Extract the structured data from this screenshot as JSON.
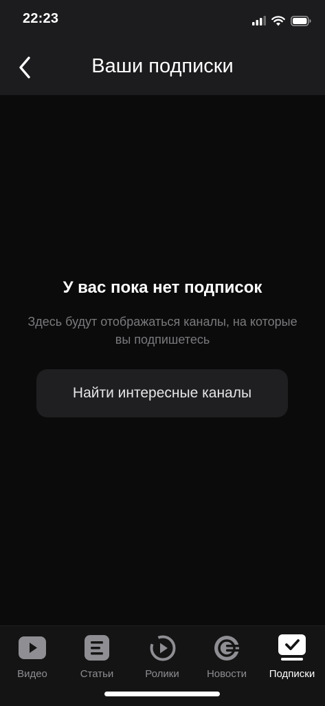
{
  "status_bar": {
    "time": "22:23"
  },
  "header": {
    "title": "Ваши подписки",
    "back_icon": "chevron-left-icon"
  },
  "empty_state": {
    "title": "У вас пока нет подписок",
    "description": "Здесь будут отображаться каналы, на которые вы подпишетесь",
    "button_label": "Найти интересные каналы"
  },
  "tab_bar": {
    "active_index": 4,
    "items": [
      {
        "label": "Видео",
        "icon": "play-icon"
      },
      {
        "label": "Статьи",
        "icon": "article-icon"
      },
      {
        "label": "Ролики",
        "icon": "clips-icon"
      },
      {
        "label": "Новости",
        "icon": "news-icon"
      },
      {
        "label": "Подписки",
        "icon": "subscriptions-icon"
      }
    ]
  },
  "colors": {
    "background": "#0b0b0b",
    "header_background": "#1c1c1e",
    "button_background": "#1f1f21",
    "secondary_text": "#7a7a7e",
    "inactive_tab": "#8e8e93",
    "active_tab": "#ffffff"
  }
}
